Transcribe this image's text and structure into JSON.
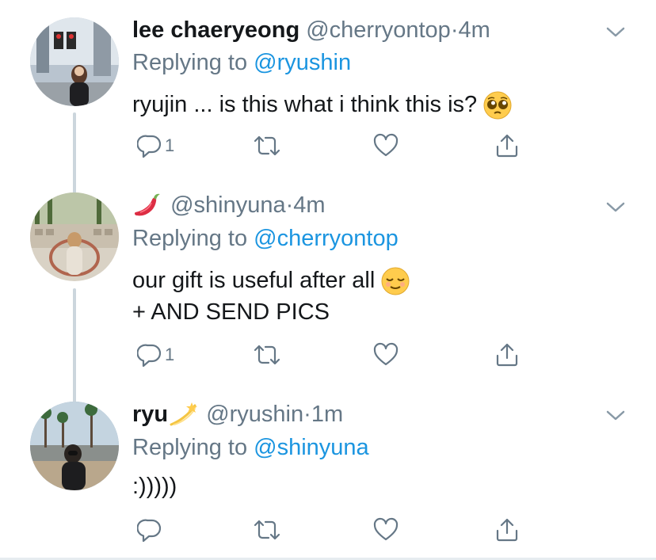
{
  "tweets": [
    {
      "display_name": "lee chaeryeong",
      "handle": "@cherryontop",
      "dot": "·",
      "time": "4m",
      "replying_prefix": "Replying to",
      "replying_mention": "@ryushin",
      "text_lines": [
        "ryujin ... is this what i think this is?"
      ],
      "text_emoji": "pleading-face-emoji",
      "reply_count": "1",
      "avatar_icon": "user-photo-avatar"
    },
    {
      "display_name": "",
      "name_emoji": "hot-pepper-emoji",
      "handle": "@shinyuna",
      "dot": "·",
      "time": "4m",
      "replying_prefix": "Replying to",
      "replying_mention": "@cherryontop",
      "text_lines": [
        "our gift is useful after all",
        "+ AND SEND PICS"
      ],
      "text_emoji": "relieved-face-emoji",
      "reply_count": "1",
      "avatar_icon": "user-photo-avatar"
    },
    {
      "display_name": "ryu",
      "name_emoji": "dizzy-emoji",
      "handle": "@ryushin",
      "dot": "·",
      "time": "1m",
      "replying_prefix": "Replying to",
      "replying_mention": "@shinyuna",
      "text_lines": [
        ":)))))"
      ],
      "reply_count": "",
      "avatar_icon": "user-photo-avatar"
    }
  ],
  "icons": {
    "reply": "reply-icon",
    "retweet": "retweet-icon",
    "like": "heart-icon",
    "share": "share-icon",
    "more": "chevron-down-icon"
  },
  "colors": {
    "text": "#14171a",
    "secondary": "#657786",
    "link": "#1b95e0",
    "thread_line": "#ccd6dd"
  }
}
